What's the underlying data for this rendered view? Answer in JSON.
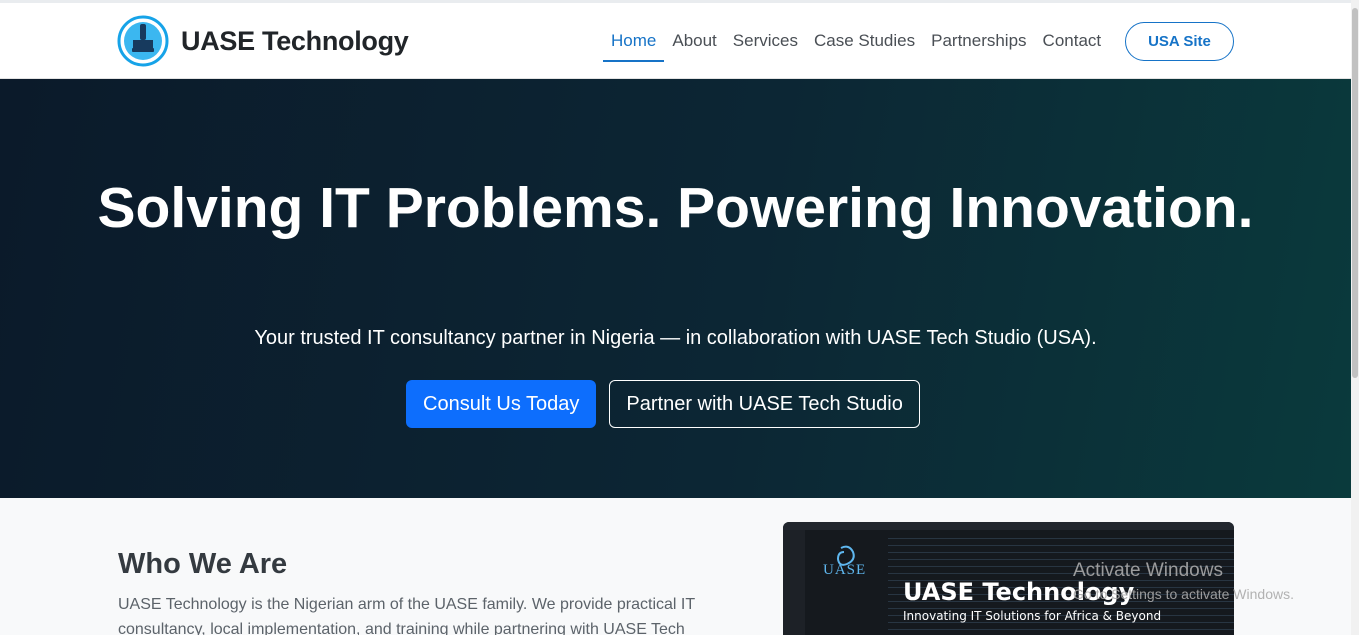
{
  "brand": {
    "name": "UASE Technology",
    "logo_icon": "brush-icon"
  },
  "nav": {
    "items": [
      {
        "label": "Home",
        "active": true
      },
      {
        "label": "About"
      },
      {
        "label": "Services"
      },
      {
        "label": "Case Studies"
      },
      {
        "label": "Partnerships"
      },
      {
        "label": "Contact"
      }
    ],
    "usa_site": "USA Site"
  },
  "hero": {
    "title": "Solving IT Problems. Powering Innovation.",
    "subtitle": "Your trusted IT consultancy partner in Nigeria — in collaboration with UASE Tech Studio (USA).",
    "primary_button": "Consult Us Today",
    "secondary_button": "Partner with UASE Tech Studio"
  },
  "about": {
    "title": "Who We Are",
    "text": "UASE Technology is the Nigerian arm of the UASE family. We provide practical IT consultancy, local implementation, and training while partnering with UASE Tech"
  },
  "image_card": {
    "logo_text": "UASE",
    "title": "UASE Technology",
    "tagline": "Innovating IT Solutions for Africa & Beyond"
  },
  "watermark": {
    "title": "Activate Windows",
    "subtitle": "Go to Settings to activate Windows."
  },
  "colors": {
    "accent": "#1673c7",
    "primary_button": "#0d6efd",
    "hero_bg_start": "#0b1a2a",
    "hero_bg_end": "#0a3a3c"
  }
}
